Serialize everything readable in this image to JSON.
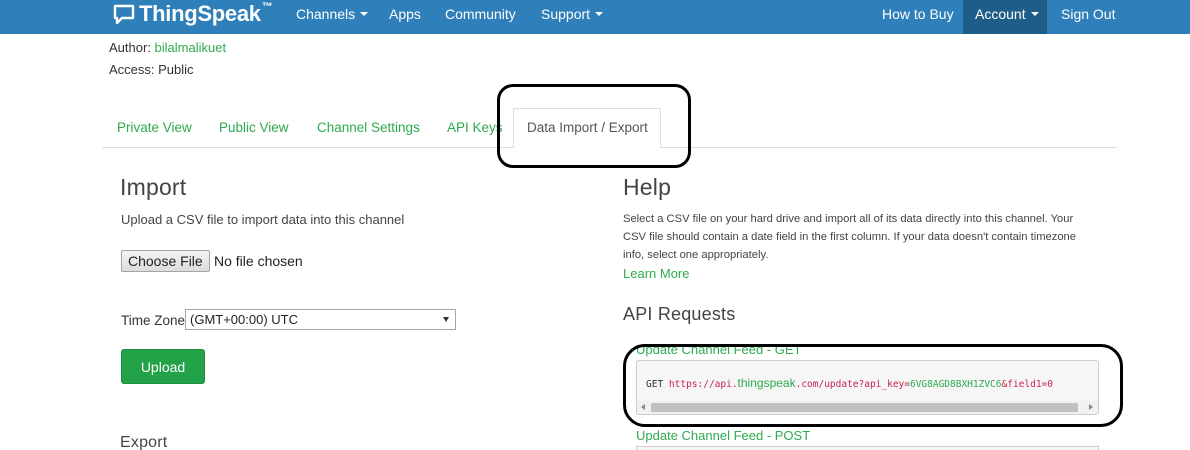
{
  "navbar": {
    "brand": "ThingSpeak",
    "brand_mark": "™",
    "items": [
      {
        "label": "Channels"
      },
      {
        "label": "Apps"
      },
      {
        "label": "Community"
      },
      {
        "label": "Support"
      }
    ],
    "right_items": [
      {
        "label": "How to Buy"
      },
      {
        "label": "Account"
      },
      {
        "label": "Sign Out"
      }
    ],
    "colors": {
      "bar": "#2f7fba",
      "active": "#1e5d88"
    }
  },
  "channel": {
    "author_label": "Author:",
    "author_value": "bilalmalikuet",
    "access_label": "Access:",
    "access_value": "Public"
  },
  "tabs": [
    {
      "label": "Private View"
    },
    {
      "label": "Public View"
    },
    {
      "label": "Channel Settings"
    },
    {
      "label": "API Keys"
    },
    {
      "label": "Data Import / Export",
      "active": true
    }
  ],
  "import": {
    "title": "Import",
    "description": "Upload a CSV file to import data into this channel",
    "choose_button": "Choose File",
    "file_status": "No file chosen",
    "timezone_label": "Time Zone",
    "timezone_value": "(GMT+00:00) UTC",
    "upload_button": "Upload"
  },
  "export": {
    "title": "Export"
  },
  "help": {
    "title": "Help",
    "line1": "Select a CSV file on your hard drive and import all of its data directly into this channel. Your",
    "line2": "CSV file should contain a date field in the first column. If your data doesn't contain timezone",
    "line3": "info, select one appropriately.",
    "learn_more": "Learn More"
  },
  "api": {
    "title": "API Requests",
    "get_title": "Update Channel Feed - GET",
    "get_method": "GET",
    "get_url_prefix": "https://api.",
    "get_url_host": "thingspeak",
    "get_url_path": ".com/update?api_key=",
    "get_api_key": "6VG8AGD8BXH1ZVC6",
    "get_url_suffix": "&field1=0",
    "post_title": "Update Channel Feed - POST"
  },
  "colors": {
    "accent_green": "#2eaa4f",
    "button_green": "#22a348"
  }
}
